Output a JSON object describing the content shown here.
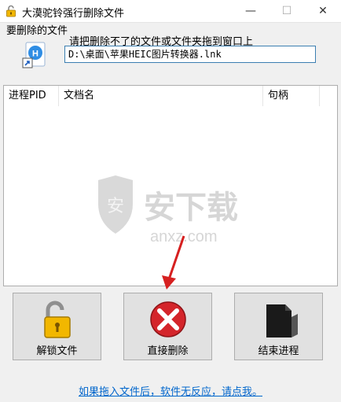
{
  "window": {
    "title": "大漠驼铃强行删除文件",
    "controls": {
      "minimize": "—",
      "maximize": "☐",
      "close": "✕"
    }
  },
  "drop_area": {
    "section_label": "要删除的文件",
    "hint": "请把删除不了的文件或文件夹拖到窗口上",
    "path_value": "D:\\桌面\\苹果HEIC图片转换器.lnk",
    "icon": "shortcut-file-icon"
  },
  "process_list": {
    "columns": [
      "进程PID",
      "文档名",
      "句柄"
    ]
  },
  "watermark": {
    "brand": "安下载",
    "domain": "anxz.com"
  },
  "actions": {
    "unlock_label": "解锁文件",
    "delete_label": "直接删除",
    "end_process_label": "结束进程",
    "unlock_icon": "padlock-open-icon",
    "delete_icon": "red-x-icon",
    "end_process_icon": "black-folder-icon"
  },
  "footer": {
    "help_link": "如果拖入文件后，软件无反应，请点我。"
  },
  "colors": {
    "link": "#0066cc",
    "input_border": "#3c7fb1",
    "annotation_arrow": "#d62020"
  }
}
